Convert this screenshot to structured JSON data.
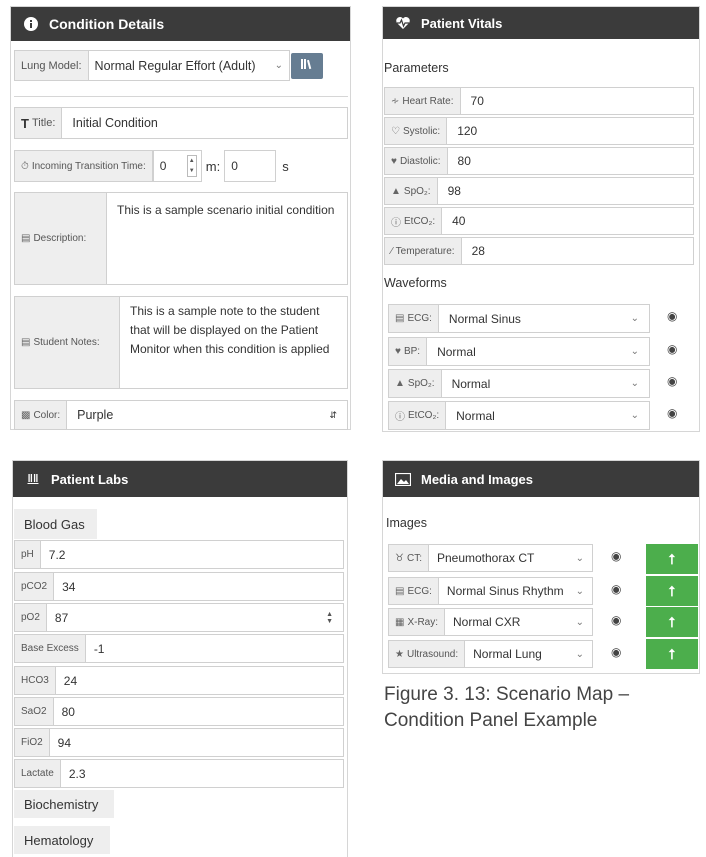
{
  "condition": {
    "header": "Condition Details",
    "lung_model_label": "Lung Model:",
    "lung_model_value": "Normal Regular Effort (Adult)",
    "title_label": "Title:",
    "title_value": "Initial Condition",
    "transition_label": "Incoming Transition Time:",
    "transition_minutes": "0",
    "transition_m_unit": "m:",
    "transition_seconds": "0",
    "transition_s_unit": "s",
    "description_label": "Description:",
    "description_value": "This is a sample scenario initial condition",
    "notes_label": "Student Notes:",
    "notes_value": "This is a sample note to the student that will be displayed on the Patient Monitor when this condition is applied",
    "color_label": "Color:",
    "color_value": "Purple"
  },
  "vitals": {
    "header": "Patient Vitals",
    "parameters_title": "Parameters",
    "parameters": [
      {
        "label": "Heart Rate:",
        "value": "70"
      },
      {
        "label": "Systolic:",
        "value": "120"
      },
      {
        "label": "Diastolic:",
        "value": "80"
      },
      {
        "label": "SpO₂:",
        "value": "98"
      },
      {
        "label": "EtCO₂:",
        "value": "40"
      },
      {
        "label": "Temperature:",
        "value": "28"
      }
    ],
    "waveforms_title": "Waveforms",
    "waveforms": [
      {
        "label": "ECG:",
        "value": "Normal Sinus"
      },
      {
        "label": "BP:",
        "value": "Normal"
      },
      {
        "label": "SpO₂:",
        "value": "Normal"
      },
      {
        "label": "EtCO₂:",
        "value": "Normal"
      }
    ]
  },
  "labs": {
    "header": "Patient Labs",
    "blood_gas_title": "Blood Gas",
    "items": [
      {
        "label": "pH",
        "value": "7.2"
      },
      {
        "label": "pCO2",
        "value": "34"
      },
      {
        "label": "pO2",
        "value": "87"
      },
      {
        "label": "Base Excess",
        "value": "-1"
      },
      {
        "label": "HCO3",
        "value": "24"
      },
      {
        "label": "SaO2",
        "value": "80"
      },
      {
        "label": "FiO2",
        "value": "94"
      },
      {
        "label": "Lactate",
        "value": "2.3"
      }
    ],
    "biochemistry_title": "Biochemistry",
    "hematology_title": "Hematology"
  },
  "media": {
    "header": "Media and Images",
    "images_title": "Images",
    "images": [
      {
        "label": "CT:",
        "value": "Pneumothorax CT"
      },
      {
        "label": "ECG:",
        "value": "Normal Sinus Rhythm"
      },
      {
        "label": "X-Ray:",
        "value": "Normal CXR"
      },
      {
        "label": "Ultrasound:",
        "value": "Normal Lung"
      }
    ]
  },
  "caption": {
    "line1": "Figure 3. 13: Scenario Map –",
    "line2": "Condition Panel Example"
  },
  "colors": {
    "header_bg": "#3b3b3b",
    "upload_green": "#4cae4c",
    "label_bg": "#eeeeee"
  }
}
